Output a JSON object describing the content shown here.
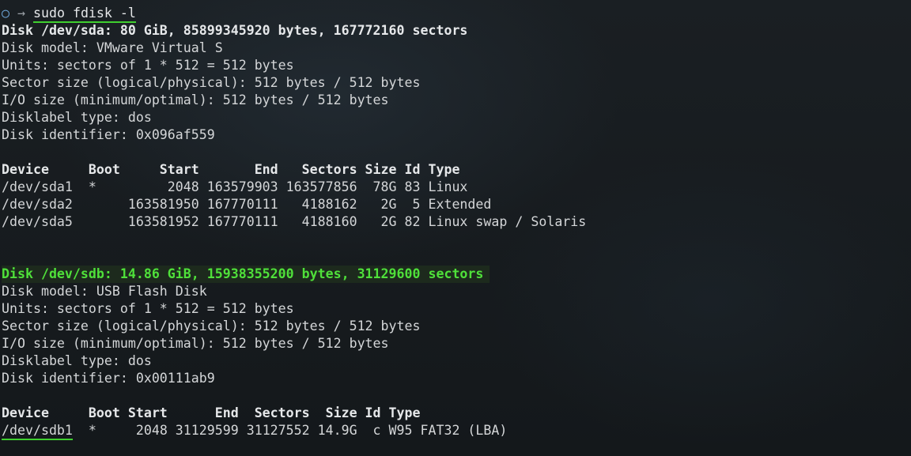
{
  "prompt": {
    "circle": "○",
    "arrow": "→",
    "command": "sudo fdisk -l"
  },
  "sda": {
    "header": "Disk /dev/sda: 80 GiB, 85899345920 bytes, 167772160 sectors",
    "info": [
      "Disk model: VMware Virtual S",
      "Units: sectors of 1 * 512 = 512 bytes",
      "Sector size (logical/physical): 512 bytes / 512 bytes",
      "I/O size (minimum/optimal): 512 bytes / 512 bytes",
      "Disklabel type: dos",
      "Disk identifier: 0x096af559"
    ],
    "table_header": "Device     Boot     Start       End   Sectors Size Id Type",
    "rows": [
      "/dev/sda1  *         2048 163579903 163577856  78G 83 Linux",
      "/dev/sda2       163581950 167770111   4188162   2G  5 Extended",
      "/dev/sda5       163581952 167770111   4188160   2G 82 Linux swap / Solaris"
    ]
  },
  "sdb": {
    "header": "Disk /dev/sdb: 14.86 GiB, 15938355200 bytes, 31129600 sectors",
    "info": [
      "Disk model: USB Flash Disk",
      "Units: sectors of 1 * 512 = 512 bytes",
      "Sector size (logical/physical): 512 bytes / 512 bytes",
      "I/O size (minimum/optimal): 512 bytes / 512 bytes",
      "Disklabel type: dos",
      "Disk identifier: 0x00111ab9"
    ],
    "table_header": "Device     Boot Start      End  Sectors  Size Id Type",
    "row_device": "/dev/sdb1",
    "row_rest": "  *     2048 31129599 31127552 14.9G  c W95 FAT32 (LBA)"
  },
  "colors": {
    "background": "#161a1d",
    "text": "#d4d6d8",
    "highlight_green": "#4fe03a",
    "underline_green": "#3fcf2f",
    "prompt_blue": "#6fa8dc"
  }
}
